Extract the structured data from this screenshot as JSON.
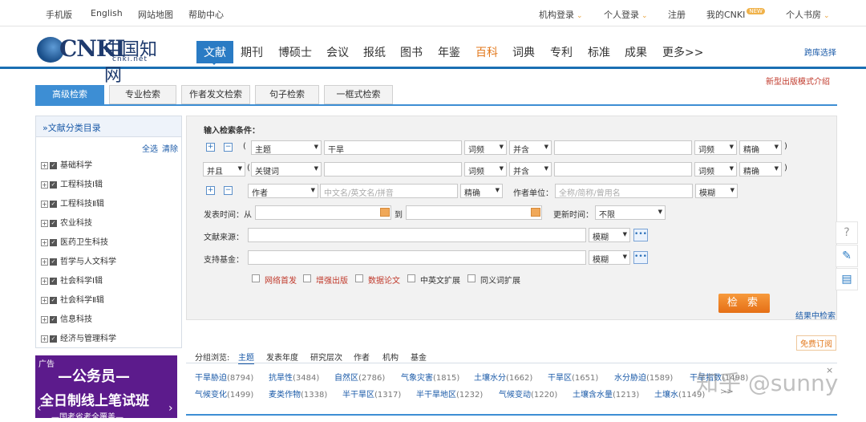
{
  "topbar": {
    "mobile": "手机版",
    "english": "English",
    "sitemap": "网站地图",
    "help": "帮助中心",
    "inst_login": "机构登录",
    "user_login": "个人登录",
    "register": "注册",
    "my_cnki": "我的CNKI",
    "new_badge": "NEW",
    "bookroom": "个人书房"
  },
  "logo": {
    "text": "CNKI",
    "cn": "中国知网",
    "url": "cnki.net"
  },
  "nav": {
    "items": [
      "文献",
      "期刊",
      "博硕士",
      "会议",
      "报纸",
      "图书",
      "年鉴",
      "百科",
      "词典",
      "专利",
      "标准",
      "成果",
      "更多>>"
    ],
    "cross_db": "跨库选择"
  },
  "new_version_link": "新型出版模式介绍",
  "search_tabs": [
    "高级检索",
    "专业检索",
    "作者发文检索",
    "句子检索",
    "一框式检索"
  ],
  "left_panel": {
    "title": "文献分类目录",
    "title_prefix": "»",
    "select_all": "全选",
    "clear": "清除",
    "categories": [
      "基础科学",
      "工程科技Ⅰ辑",
      "工程科技Ⅱ辑",
      "农业科技",
      "医药卫生科技",
      "哲学与人文科学",
      "社会科学Ⅰ辑",
      "社会科学Ⅱ辑",
      "信息科技",
      "经济与管理科学"
    ]
  },
  "search": {
    "title": "输入检索条件：",
    "row1": {
      "field": "主题",
      "value": "干旱",
      "freq": "词频",
      "logic": "并含",
      "freq2": "词频",
      "match": "精确"
    },
    "row2": {
      "logic0": "并且",
      "field": "关键词",
      "freq": "词频",
      "logic": "并含",
      "freq2": "词频",
      "match": "精确"
    },
    "row3": {
      "field": "作者",
      "placeholder": "中文名/英文名/拼音",
      "match": "精确",
      "unit_label": "作者单位：",
      "unit_placeholder": "全称/简称/曾用名",
      "unit_match": "模糊"
    },
    "date": {
      "label": "发表时间：从",
      "to": "到",
      "update_label": "更新时间：",
      "update_value": "不限"
    },
    "source": {
      "label": "文献来源：",
      "match": "模糊"
    },
    "fund": {
      "label": "支持基金：",
      "match": "模糊"
    },
    "options": [
      "网络首发",
      "增强出版",
      "数据论文",
      "中英文扩展",
      "同义词扩展"
    ],
    "button": "检 索",
    "within_results": "结果中检索"
  },
  "subscribe": "免费订阅",
  "ad": {
    "tag": "广告",
    "line1": "—公务员—",
    "line2": "全日制线上笔试班",
    "line3": "—国考省考全覆盖—"
  },
  "group": {
    "label": "分组浏览:",
    "tabs": [
      "主题",
      "发表年度",
      "研究层次",
      "作者",
      "机构",
      "基金"
    ],
    "row1": [
      {
        "t": "干旱胁迫",
        "n": "(8794)"
      },
      {
        "t": "抗旱性",
        "n": "(3484)"
      },
      {
        "t": "自然区",
        "n": "(2786)"
      },
      {
        "t": "气象灾害",
        "n": "(1815)"
      },
      {
        "t": "土壤水分",
        "n": "(1662)"
      },
      {
        "t": "干旱区",
        "n": "(1651)"
      },
      {
        "t": "水分胁迫",
        "n": "(1589)"
      },
      {
        "t": "干旱指数",
        "n": "(1498)"
      }
    ],
    "row2": [
      {
        "t": "气候变化",
        "n": "(1499)"
      },
      {
        "t": "麦类作物",
        "n": "(1338)"
      },
      {
        "t": "半干旱区",
        "n": "(1317)"
      },
      {
        "t": "半干旱地区",
        "n": "(1232)"
      },
      {
        "t": "气候变动",
        "n": "(1220)"
      },
      {
        "t": "土壤含水量",
        "n": "(1213)"
      },
      {
        "t": "土壤水",
        "n": "(1149)"
      }
    ],
    "more": ">>",
    "close": "×"
  },
  "watermark": "知乎 @sunny"
}
